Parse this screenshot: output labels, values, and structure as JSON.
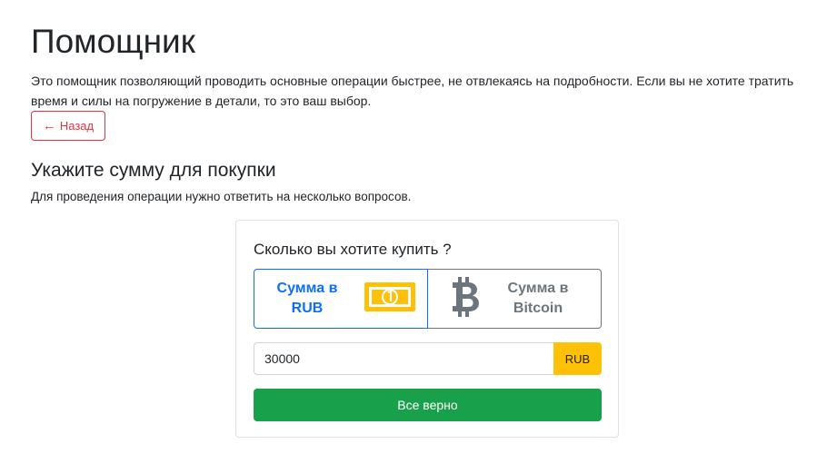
{
  "page": {
    "title": "Помощник",
    "intro": "Это помощник позволяющий проводить основные операции быстрее, не отвлекаясь на подробности. Если вы не хотите тратить время и силы на погружение в детали, то это ваш выбор.",
    "back_button": {
      "arrow": "←",
      "label": "Назад"
    }
  },
  "step": {
    "title": "Укажите сумму для покупки",
    "description": "Для проведения операции нужно ответить на несколько вопросов."
  },
  "card": {
    "title": "Сколько вы хотите купить ?",
    "options": [
      {
        "label": "Сумма в\nRUB",
        "icon": "banknote-icon",
        "selected": true
      },
      {
        "label": "Сумма в\nBitcoin",
        "icon": "bitcoin-icon",
        "selected": false
      }
    ],
    "amount": {
      "value": "30000",
      "currency": "RUB"
    },
    "confirm_label": "Все верно"
  },
  "colors": {
    "danger": "#dc3545",
    "primary": "#0d6efd",
    "secondary": "#6c757d",
    "warning": "#ffc107",
    "success": "#19a04a"
  }
}
